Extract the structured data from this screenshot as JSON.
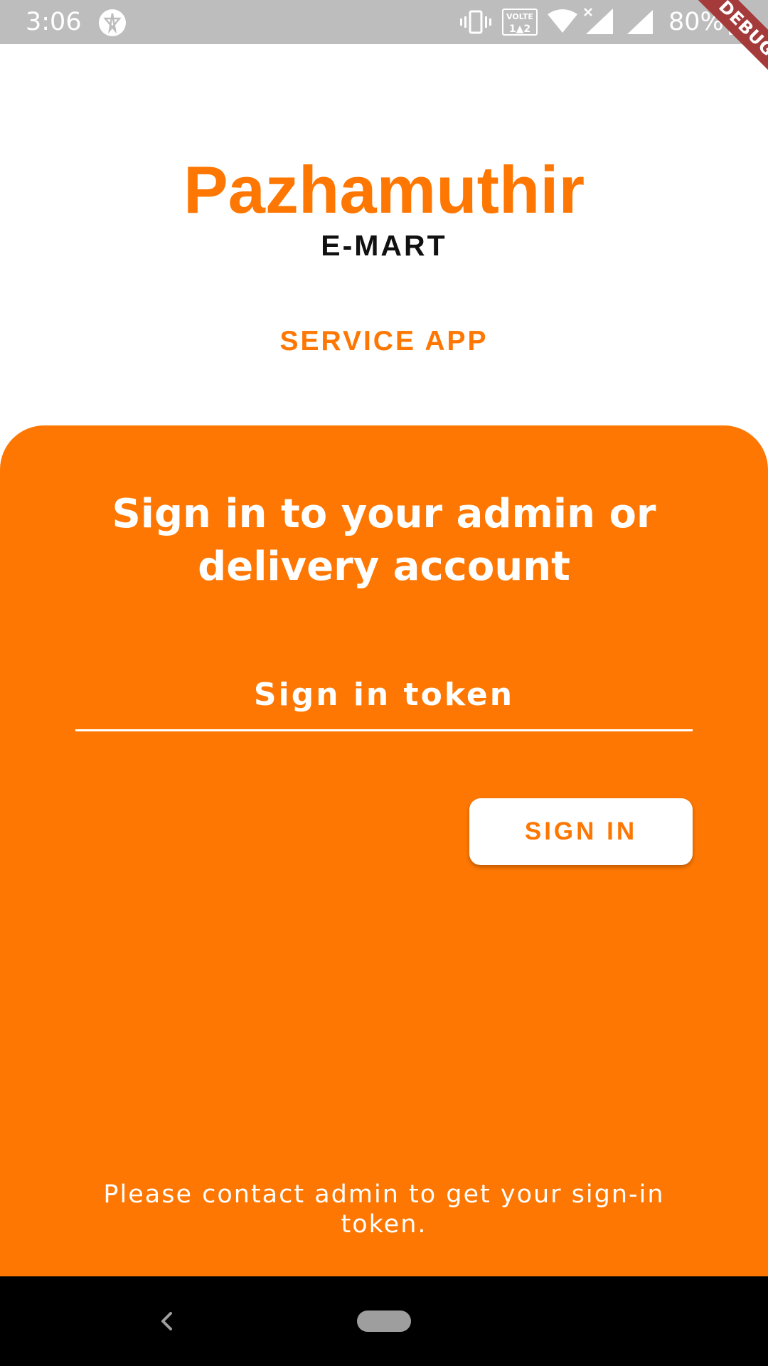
{
  "status_bar": {
    "time": "3:06",
    "battery_percent": "80%",
    "icons": [
      "app-notification-icon",
      "vibrate-icon",
      "volte-icon",
      "wifi-icon",
      "signal-no-data-icon",
      "signal-icon",
      "battery-icon"
    ],
    "background": "#bdbdbd"
  },
  "debug_banner": {
    "label": "DEBUG",
    "color": "#a53a3a"
  },
  "header": {
    "title": "Pazhamuthir",
    "subtitle": "E-MART",
    "service_label": "SERVICE APP"
  },
  "login_card": {
    "heading": "Sign in to your admin or delivery account",
    "token_input": {
      "placeholder": "Sign in token",
      "value": ""
    },
    "sign_in_button": "SIGN IN",
    "contact_note": "Please contact admin to get your sign-in token."
  },
  "nav_bar": {
    "icons": [
      "back-icon",
      "home-pill-icon"
    ]
  },
  "colors": {
    "accent": "#fd7702",
    "text_dark": "#111111",
    "white": "#ffffff"
  }
}
